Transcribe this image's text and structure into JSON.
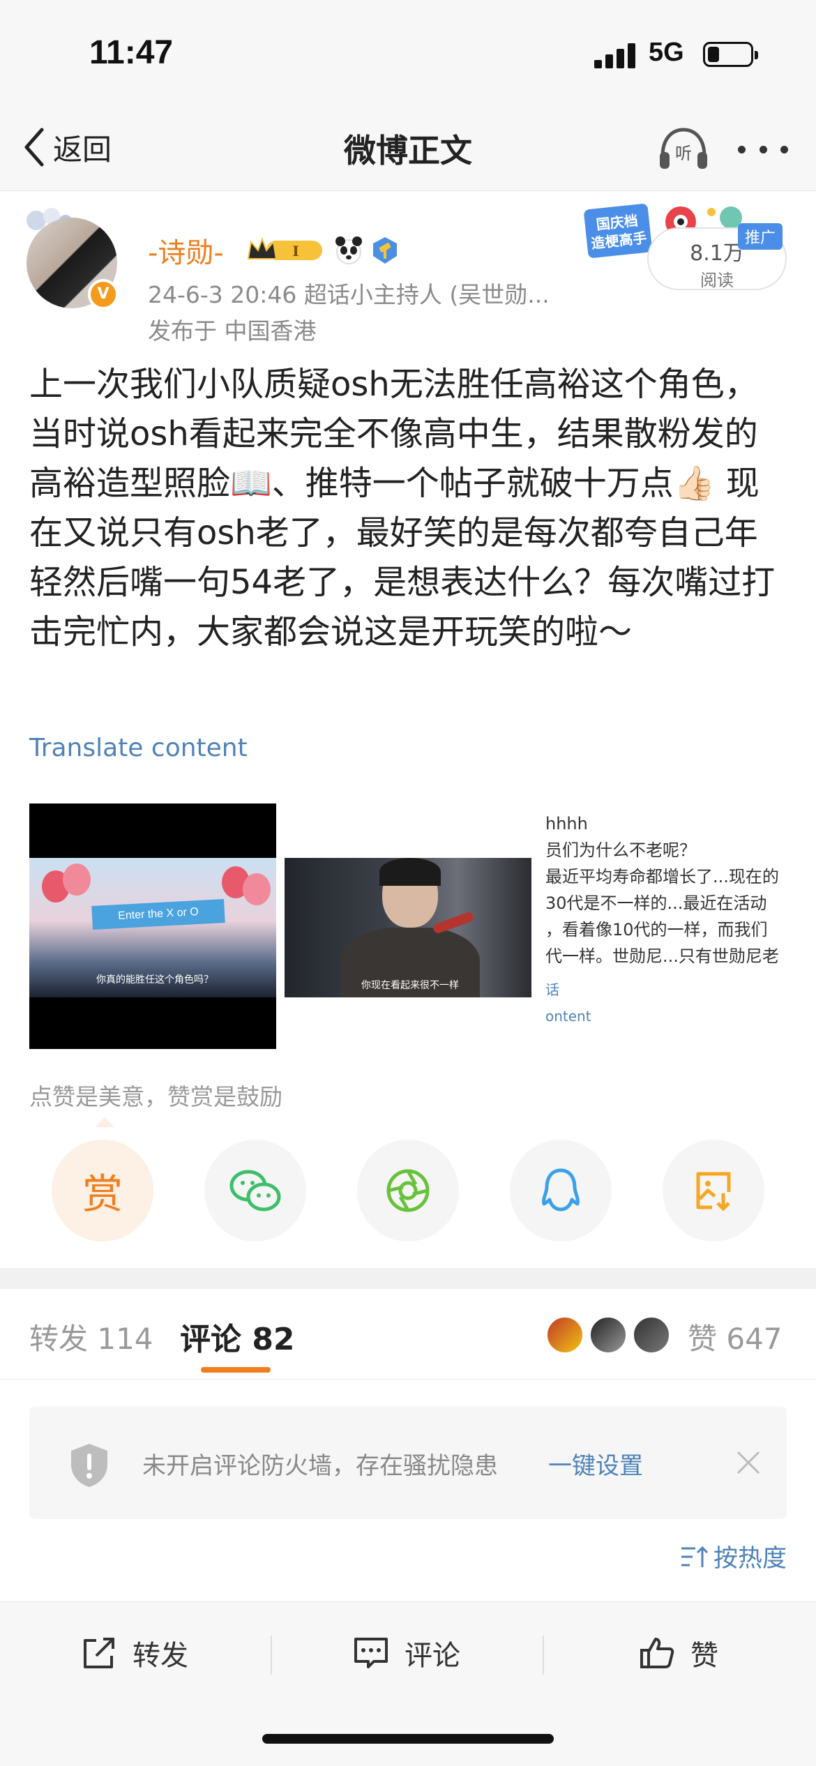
{
  "status_bar": {
    "time": "11:47",
    "network": "5G"
  },
  "nav": {
    "back_label": "返回",
    "title": "微博正文"
  },
  "post": {
    "author": "-诗勋-",
    "meta": "24-6-3 20:46  超话小主持人 (吴世勋...",
    "location": "发布于 中国香港",
    "read_count": "8.1万",
    "read_label": "阅读",
    "promo_text": "国庆档 造梗高手",
    "promo_tag": "推广",
    "text": "上一次我们小队质疑osh无法胜任高裕这个角色，当时说osh看起来完全不像高中生，结果散粉发的高裕造型照脸📖、推特一个帖子就破十万点👍🏻 现在又说只有osh老了，最好笑的是每次都夸自己年轻然后嘴一句54老了，是想表达什么？每次嘴过打击完忙内，大家都会说这是开玩笑的啦～",
    "translate_label": "Translate content",
    "images": {
      "img1_banner": "Enter the X or O",
      "img1_subtitle": "你真的能胜任这个角色吗？",
      "img2_subtitle": "你现在看起来很不一样",
      "img3_lines": [
        "hhhh",
        "员们为什么不老呢？",
        "最近平均寿命都增长了...现在的",
        "30代是不一样的...最近在活动",
        "，看着像10代的一样，而我们",
        "代一样。世勋尼...只有世勋尼老"
      ],
      "img3_link1": "话",
      "img3_link2": "ontent"
    }
  },
  "tip": "点赞是美意，赞赏是鼓励",
  "share": {
    "reward_label": "赏"
  },
  "tabs": {
    "repost": "转发 114",
    "comments": "评论 82",
    "likes": "赞 647"
  },
  "firewall": {
    "text": "未开启评论防火墙，存在骚扰隐患",
    "link": "一键设置"
  },
  "sort_label": "按热度",
  "bottom_bar": {
    "repost": "转发",
    "comment": "评论",
    "like": "赞"
  },
  "colors": {
    "accent_orange": "#f07e1e",
    "link_blue": "#4f83b8",
    "wechat_green": "#3dbf6a",
    "moments_green": "#67c23a",
    "qq_blue": "#3aa1e8",
    "album_orange": "#f5a623"
  }
}
